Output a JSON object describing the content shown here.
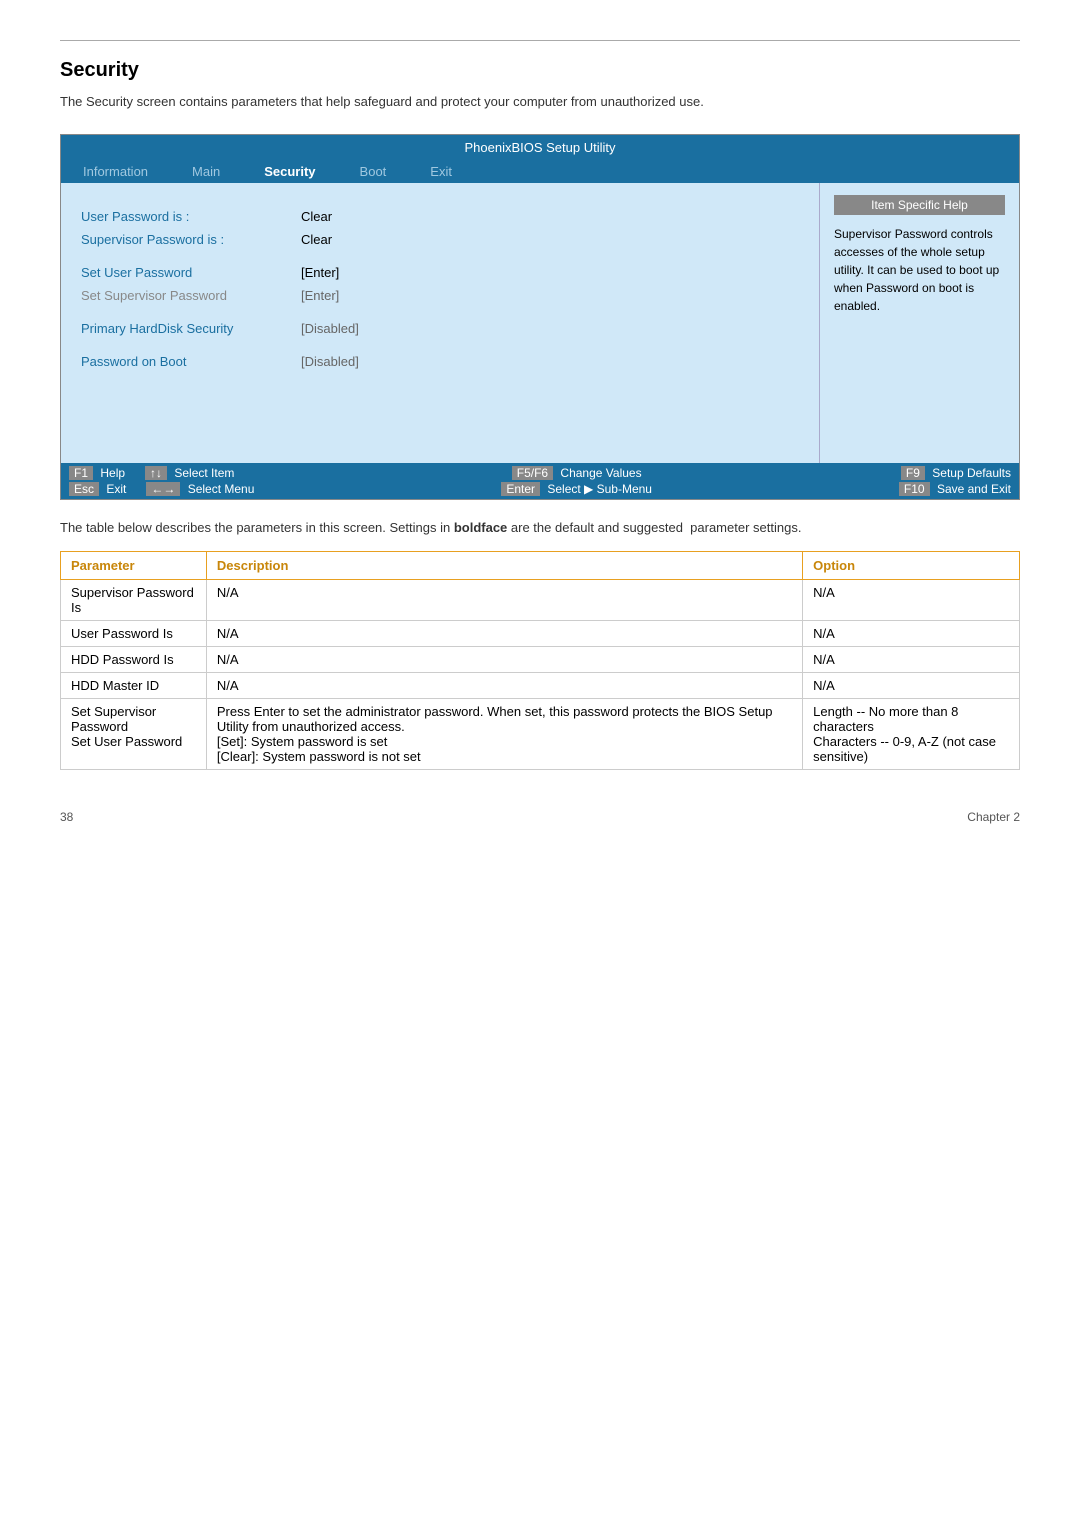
{
  "page": {
    "top_divider": true,
    "title": "Security",
    "description": "The Security screen contains parameters that help safeguard and protect your computer from unauthorized use."
  },
  "bios": {
    "title": "PhoenixBIOS Setup Utility",
    "nav_items": [
      {
        "label": "Information",
        "active": false
      },
      {
        "label": "Main",
        "active": false
      },
      {
        "label": "Security",
        "active": true
      },
      {
        "label": "Boot",
        "active": false
      },
      {
        "label": "Exit",
        "active": false
      }
    ],
    "fields": [
      {
        "label": "User Password is :",
        "value": "Clear",
        "label_disabled": false,
        "value_disabled": false
      },
      {
        "label": "Supervisor Password is :",
        "value": "Clear",
        "label_disabled": false,
        "value_disabled": false
      },
      {
        "label": "Set User Password",
        "value": "[Enter]",
        "label_disabled": false,
        "value_disabled": false
      },
      {
        "label": "Set Supervisor Password",
        "value": "[Enter]",
        "label_disabled": true,
        "value_disabled": true
      },
      {
        "label": "Primary HardDisk Security",
        "value": "[Disabled]",
        "label_disabled": false,
        "value_disabled": true
      },
      {
        "label": "Password on Boot",
        "value": "[Disabled]",
        "label_disabled": false,
        "value_disabled": true
      }
    ],
    "help_title": "Item Specific Help",
    "help_text": "Supervisor Password controls accesses of the whole setup utility. It can be used to boot up when Password on boot is enabled.",
    "statusbar": {
      "left_rows": [
        {
          "key": "F1",
          "label": "Help",
          "key2": "↑↓",
          "label2": "Select Item"
        },
        {
          "key": "Esc",
          "label": "Exit",
          "key2": "←→",
          "label2": "Select Menu"
        }
      ],
      "middle_rows": [
        {
          "key": "F5/F6",
          "label": "Change Values"
        },
        {
          "key": "Enter",
          "label": "Select ▶ Sub-Menu"
        }
      ],
      "right_rows": [
        {
          "key": "F9",
          "label": "Setup Defaults"
        },
        {
          "key": "F10",
          "label": "Save and Exit"
        }
      ]
    }
  },
  "table_desc": "The table below describes the parameters in this screen. Settings in boldface are the default and suggested  parameter settings.",
  "table": {
    "headers": [
      "Parameter",
      "Description",
      "Option"
    ],
    "rows": [
      {
        "parameter": "Supervisor Password Is",
        "description": "N/A",
        "option": "N/A"
      },
      {
        "parameter": "User Password Is",
        "description": "N/A",
        "option": "N/A"
      },
      {
        "parameter": "HDD Password Is",
        "description": "N/A",
        "option": "N/A"
      },
      {
        "parameter": "HDD Master ID",
        "description": "N/A",
        "option": "N/A"
      },
      {
        "parameter": "Set Supervisor Password\nSet User Password",
        "description": "Press Enter to set the administrator password. When set, this password protects the BIOS Setup Utility from unauthorized access.\n[Set]: System password is set\n[Clear]: System password is not set",
        "option": "Length -- No more than 8 characters\nCharacters -- 0-9, A-Z (not case sensitive)"
      }
    ]
  },
  "footer": {
    "page_number": "38",
    "chapter": "Chapter 2"
  }
}
